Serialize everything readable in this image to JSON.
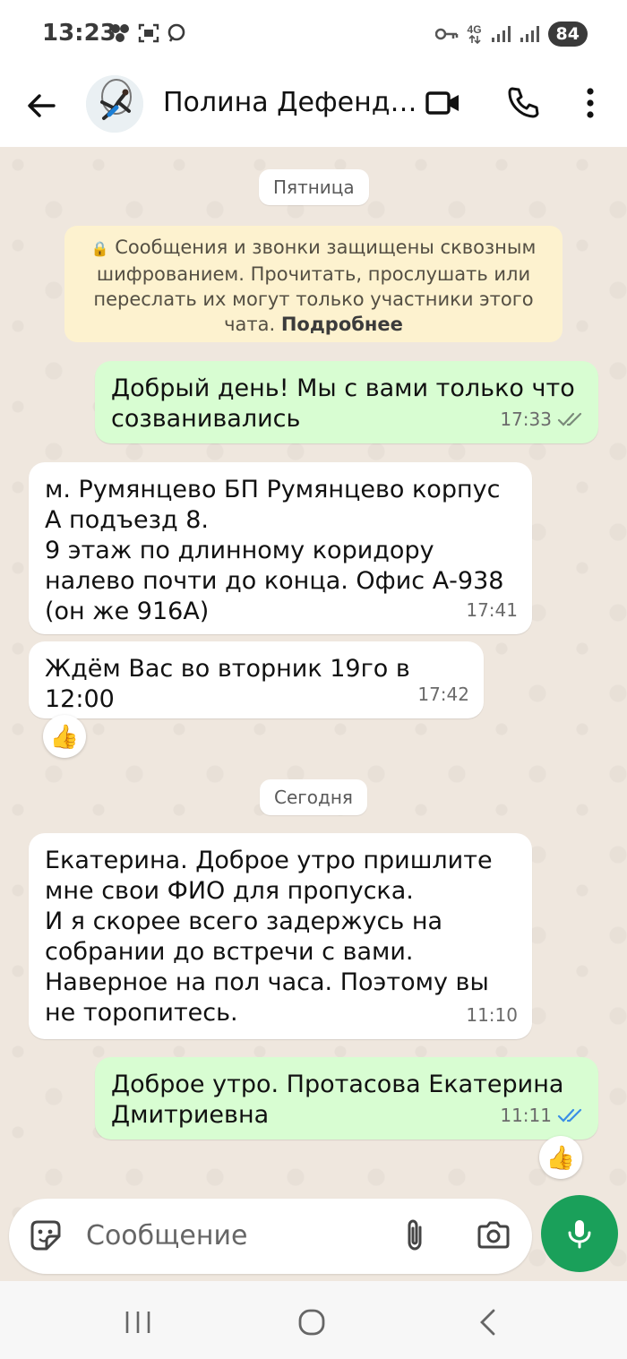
{
  "status_bar": {
    "time": "13:23",
    "network": "4G",
    "battery": "84"
  },
  "header": {
    "contact_name": "Полина Дефенд…"
  },
  "chat": {
    "day_friday": "Пятница",
    "encryption_notice": "Сообщения и звонки защищены сквозным шифрованием. Прочитать, прослушать или переслать их могут только участники этого чата.",
    "encryption_link": "Подробнее",
    "messages": [
      {
        "direction": "out",
        "text": "Добрый день! Мы с вами только что созванивались",
        "time": "17:33",
        "status": "read-grey"
      },
      {
        "direction": "in",
        "text": "м. Румянцево БП Румянцево корпус А подъезд 8.\n9 этаж по длинному коридору налево почти до конца. Офис А-938 (он же 916А)",
        "time": "17:41"
      },
      {
        "direction": "in",
        "text": "Ждём Вас во вторник 19го в 12:00",
        "time": "17:42",
        "reaction": "👍"
      },
      {
        "direction": "in",
        "text": "Екатерина. Доброе утро пришлите мне свои ФИО для пропуска.\nИ я скорее всего задержусь на собрании до встречи с вами. Наверное на пол часа. Поэтому вы не торопитесь.",
        "time": "11:10"
      },
      {
        "direction": "out",
        "text": "Доброе утро. Протасова Екатерина Дмитриевна",
        "time": "11:11",
        "status": "read-blue",
        "reaction": "👍"
      }
    ],
    "day_today": "Сегодня"
  },
  "composer": {
    "placeholder": "Сообщение"
  },
  "colors": {
    "accent_green": "#1aa05a",
    "outgoing_bubble": "#d8fdd2",
    "read_tick_blue": "#3a8ee6"
  }
}
